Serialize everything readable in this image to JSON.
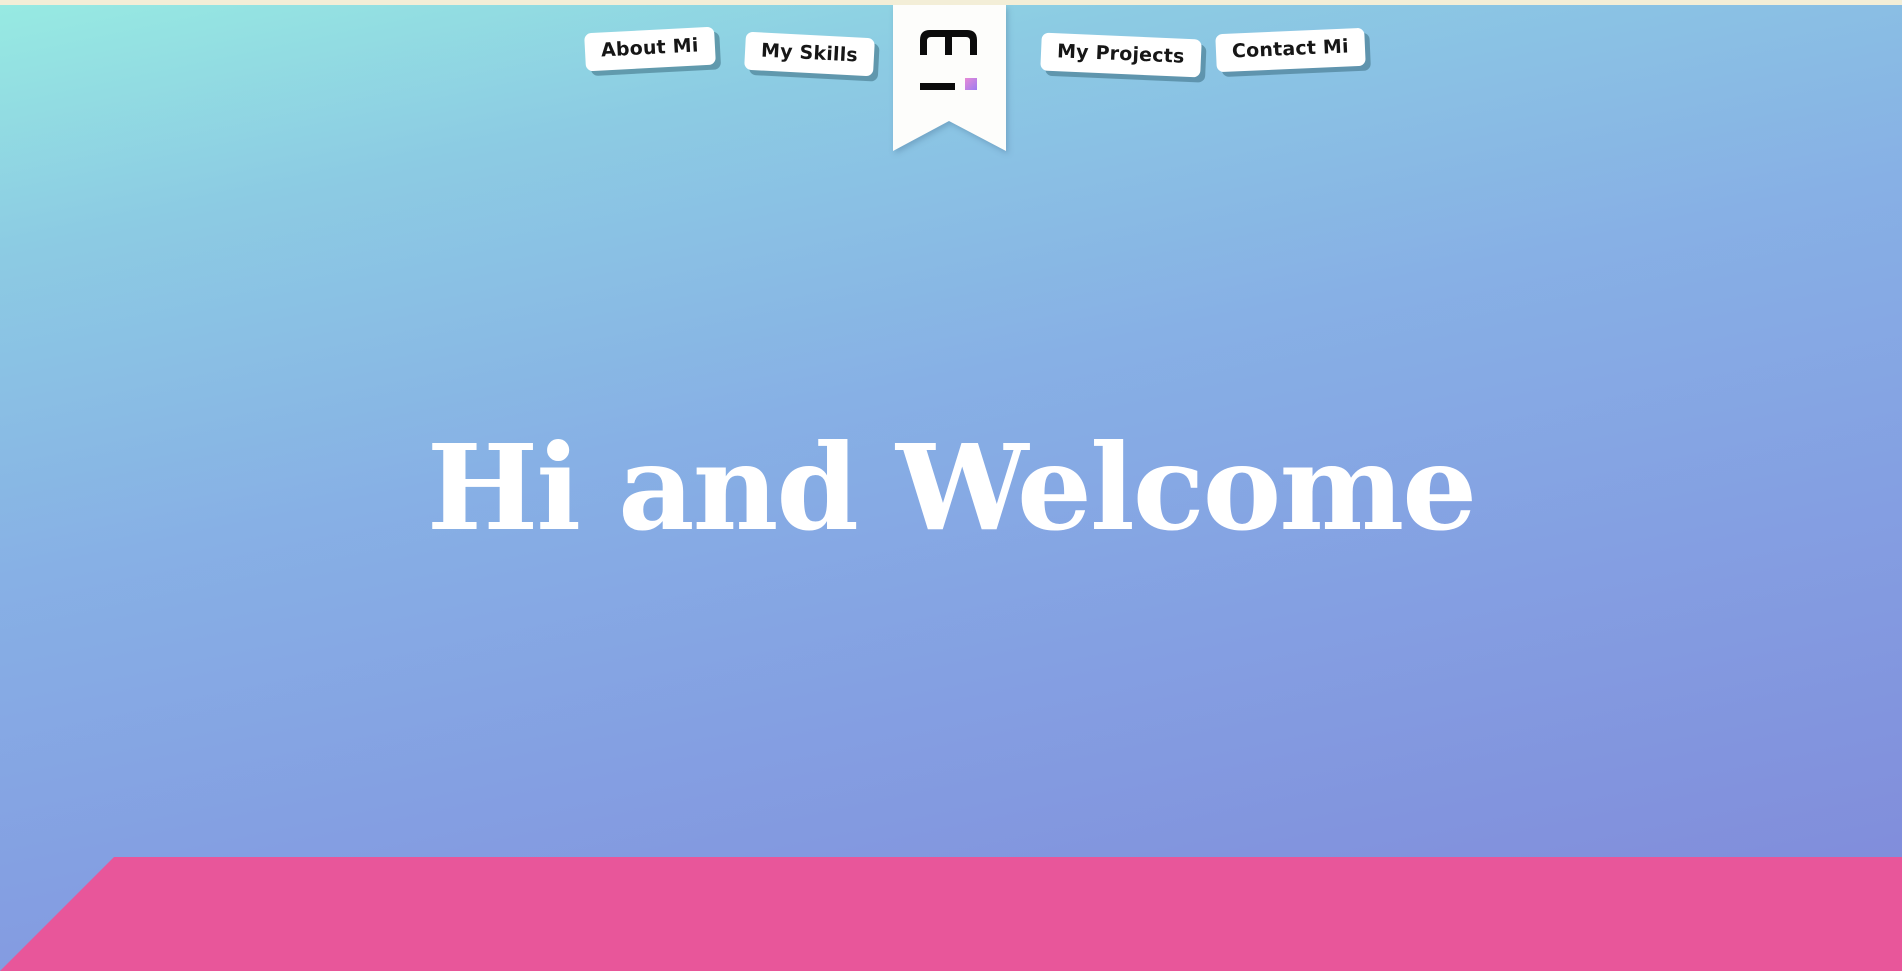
{
  "nav": {
    "items": [
      {
        "label": "About Mi"
      },
      {
        "label": "My Skills"
      },
      {
        "label": "My Projects"
      },
      {
        "label": "Contact Mi"
      }
    ],
    "logo_icon": "mi-monogram-icon"
  },
  "hero": {
    "title": "Hi and Welcome"
  },
  "colors": {
    "gradient_top": "#97eae2",
    "gradient_bottom": "#8088d9",
    "footer_band": "#e8569a",
    "nav_tag_bg": "#ffffff",
    "logo_accent": "#b98cf0"
  }
}
